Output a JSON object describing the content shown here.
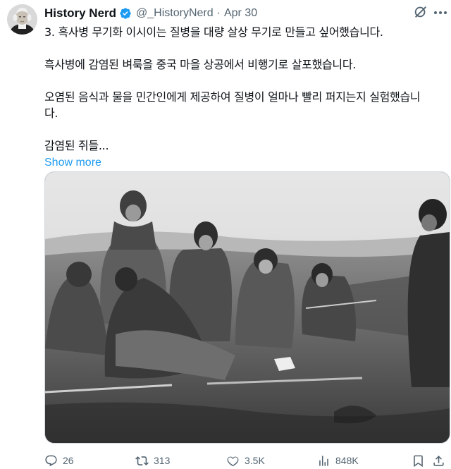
{
  "author": {
    "name": "History Nerd",
    "handle": "@_HistoryNerd",
    "separator": "·",
    "date": "Apr 30"
  },
  "tweet": {
    "line1": "3. 흑사병 무기화 이시이는 질병을 대량 살상 무기로 만들고 싶어했습니다.",
    "line2": "흑사병에 감염된 벼룩을 중국 마을 상공에서 비행기로 살포했습니다.",
    "line3a": "오염된 음식과 물을 민간인에게 제공하여 질병이 얼마나 빨리 퍼지는지 실험했습니",
    "line3b": "다.",
    "line4": "감염된 쥐들...",
    "show_more": "Show more"
  },
  "actions": {
    "replies": "26",
    "reposts": "313",
    "likes": "3.5K",
    "views": "848K"
  },
  "colors": {
    "link": "#1d9bf0",
    "verified": "#1d9bf0",
    "muted": "#536471"
  },
  "icons": [
    "avatar",
    "verified-badge-icon",
    "grok-icon",
    "more-icon",
    "reply-icon",
    "repost-icon",
    "like-icon",
    "views-icon",
    "bookmark-icon",
    "share-icon"
  ]
}
